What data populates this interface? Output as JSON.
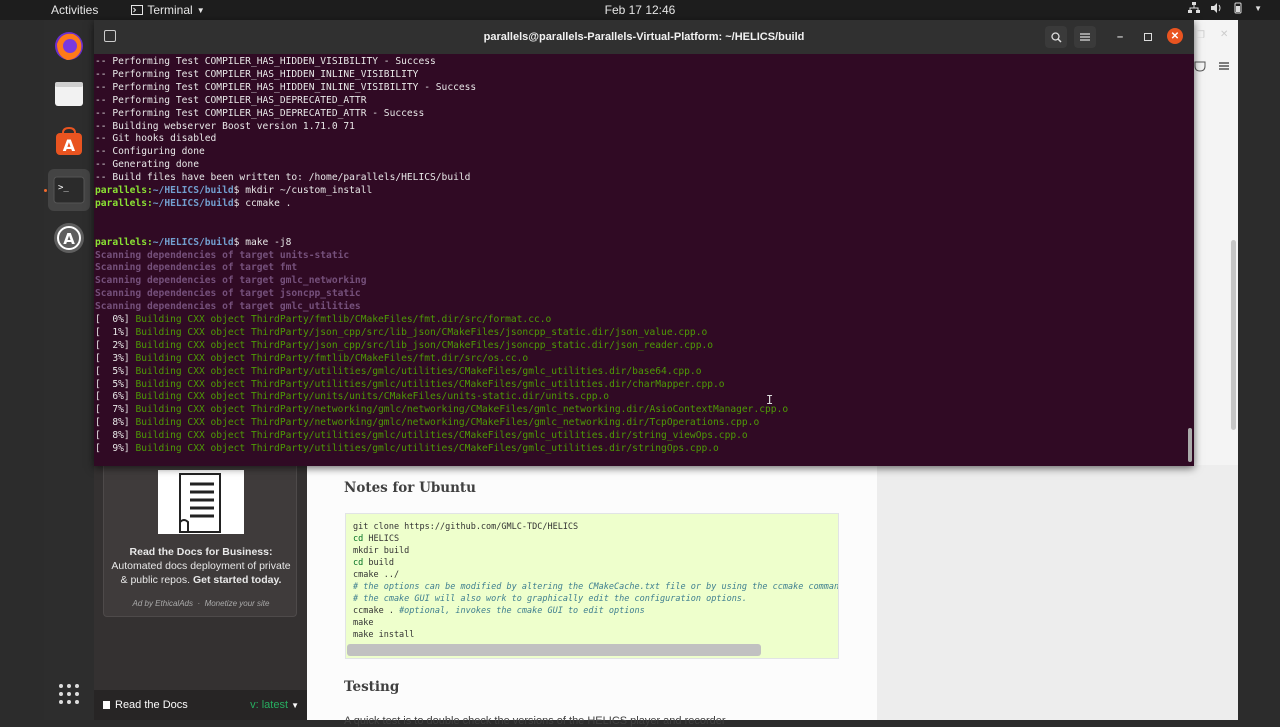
{
  "topbar": {
    "activities": "Activities",
    "app_name": "Terminal",
    "clock": "Feb 17  12:46"
  },
  "dock": {
    "items": [
      "firefox",
      "files",
      "software",
      "terminal",
      "software-updater"
    ],
    "apps_grid": "show-applications"
  },
  "terminal": {
    "title": "parallels@parallels-Parallels-Virtual-Platform: ~/HELICS/build",
    "prompt_user": "parallels:",
    "prompt_path": "~/HELICS/build",
    "lines_plain": [
      "-- Performing Test COMPILER_HAS_HIDDEN_VISIBILITY - Success",
      "-- Performing Test COMPILER_HAS_HIDDEN_INLINE_VISIBILITY",
      "-- Performing Test COMPILER_HAS_HIDDEN_INLINE_VISIBILITY - Success",
      "-- Performing Test COMPILER_HAS_DEPRECATED_ATTR",
      "-- Performing Test COMPILER_HAS_DEPRECATED_ATTR - Success",
      "-- Building webserver Boost version 1.71.0 71",
      "-- Git hooks disabled",
      "-- Configuring done",
      "-- Generating done",
      "-- Build files have been written to: /home/parallels/HELICS/build"
    ],
    "commands": [
      "$ mkdir ~/custom_install",
      "$ ccmake .",
      "$ make -j8"
    ],
    "scan_lines": [
      "Scanning dependencies of target units-static",
      "Scanning dependencies of target fmt",
      "Scanning dependencies of target gmlc_networking",
      "Scanning dependencies of target jsoncpp_static",
      "Scanning dependencies of target gmlc_utilities"
    ],
    "build_lines": [
      {
        "pct": "[  0%] ",
        "text": "Building CXX object ThirdParty/fmtlib/CMakeFiles/fmt.dir/src/format.cc.o"
      },
      {
        "pct": "[  1%] ",
        "text": "Building CXX object ThirdParty/json_cpp/src/lib_json/CMakeFiles/jsoncpp_static.dir/json_value.cpp.o"
      },
      {
        "pct": "[  2%] ",
        "text": "Building CXX object ThirdParty/json_cpp/src/lib_json/CMakeFiles/jsoncpp_static.dir/json_reader.cpp.o"
      },
      {
        "pct": "[  3%] ",
        "text": "Building CXX object ThirdParty/fmtlib/CMakeFiles/fmt.dir/src/os.cc.o"
      },
      {
        "pct": "[  5%] ",
        "text": "Building CXX object ThirdParty/utilities/gmlc/utilities/CMakeFiles/gmlc_utilities.dir/base64.cpp.o"
      },
      {
        "pct": "[  5%] ",
        "text": "Building CXX object ThirdParty/utilities/gmlc/utilities/CMakeFiles/gmlc_utilities.dir/charMapper.cpp.o"
      },
      {
        "pct": "[  6%] ",
        "text": "Building CXX object ThirdParty/units/units/CMakeFiles/units-static.dir/units.cpp.o"
      },
      {
        "pct": "[  7%] ",
        "text": "Building CXX object ThirdParty/networking/gmlc/networking/CMakeFiles/gmlc_networking.dir/AsioContextManager.cpp.o"
      },
      {
        "pct": "[  8%] ",
        "text": "Building CXX object ThirdParty/networking/gmlc/networking/CMakeFiles/gmlc_networking.dir/TcpOperations.cpp.o"
      },
      {
        "pct": "[  8%] ",
        "text": "Building CXX object ThirdParty/utilities/gmlc/utilities/CMakeFiles/gmlc_utilities.dir/string_viewOps.cpp.o"
      },
      {
        "pct": "[  9%] ",
        "text": "Building CXX object ThirdParty/utilities/gmlc/utilities/CMakeFiles/gmlc_utilities.dir/stringOps.cpp.o"
      }
    ]
  },
  "sidebar": {
    "ad_title": "Read the Docs for Business:",
    "ad_body": "Automated docs deployment of private & public repos.",
    "ad_cta": "Get started today.",
    "ad_footer_left": "Ad by EthicalAds",
    "ad_footer_sep": "·",
    "ad_footer_right": "Monetize your site",
    "footer_label": "Read the Docs",
    "footer_version": "v: latest"
  },
  "content": {
    "section1": "Notes for Ubuntu",
    "code": [
      {
        "t": "git clone https://github.com/GMLC-TDC/HELICS",
        "c": ""
      },
      {
        "t": "cd",
        "rest": " HELICS",
        "c": "kw"
      },
      {
        "t": "mkdir build",
        "c": ""
      },
      {
        "t": "cd",
        "rest": " build",
        "c": "kw"
      },
      {
        "t": "cmake ../",
        "c": ""
      },
      {
        "t": "# the options can be modified by altering the CMakeCache.txt file or by using the ccmake command",
        "c": "cm"
      },
      {
        "t": "# the cmake GUI will also work to graphically edit the configuration options.",
        "c": "cm"
      },
      {
        "t": "ccmake . ",
        "rest": "#optional, invokes the cmake GUI to edit options",
        "c": "mix"
      },
      {
        "t": "make",
        "c": ""
      },
      {
        "t": "make install",
        "c": ""
      }
    ],
    "section2": "Testing",
    "para": "A quick test is to double check the versions of the HELICS player and recorder"
  }
}
